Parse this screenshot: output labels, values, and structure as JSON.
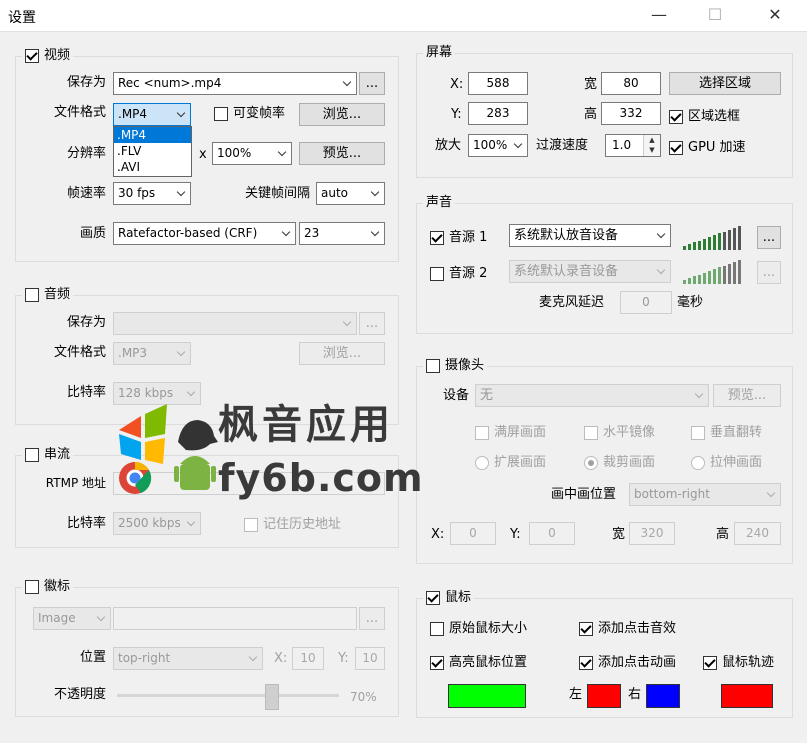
{
  "window": {
    "title": "设置",
    "minimize": "—",
    "maximize": "☐",
    "close": "✕"
  },
  "video": {
    "title": "视频",
    "save_label": "保存为",
    "save_value": "Rec <num>.mp4",
    "more": "...",
    "format_label": "文件格式",
    "format_value": ".MP4",
    "format_options": [
      ".MP4",
      ".FLV",
      ".AVI"
    ],
    "vfr_label": "可变帧率",
    "browse": "浏览...",
    "res_label": "分辨率",
    "res_x": "x",
    "scale_value": "100%",
    "preview": "预览...",
    "fps_label": "帧速率",
    "fps_value": "30 fps",
    "keyframe_label": "关键帧间隔",
    "keyframe_value": "auto",
    "quality_label": "画质",
    "quality_mode": "Ratefactor-based (CRF)",
    "quality_value": "23"
  },
  "audio": {
    "title": "音频",
    "save_label": "保存为",
    "more": "...",
    "format_label": "文件格式",
    "format_value": ".MP3",
    "browse": "浏览...",
    "bitrate_label": "比特率",
    "bitrate_value": "128 kbps"
  },
  "stream": {
    "title": "串流",
    "rtmp_label": "RTMP 地址",
    "bitrate_label": "比特率",
    "bitrate_value": "2500 kbps",
    "remember_label": "记住历史地址"
  },
  "watermark": {
    "title": "徽标",
    "type_value": "Image",
    "more": "...",
    "pos_label": "位置",
    "pos_value": "top-right",
    "x_label": "X:",
    "x_value": "10",
    "y_label": "Y:",
    "y_value": "10",
    "opacity_label": "不透明度",
    "opacity_value": "70%",
    "opacity_level": 0.7
  },
  "screen": {
    "title": "屏幕",
    "x_label": "X:",
    "x_value": "588",
    "y_label": "Y:",
    "y_value": "283",
    "w_label": "宽",
    "w_value": "80",
    "h_label": "高",
    "h_value": "332",
    "select_region": "选择区域",
    "region_frame": "区域选框",
    "zoom_label": "放大",
    "zoom_value": "100%",
    "transition_label": "过渡速度",
    "transition_value": "1.0",
    "gpu_label": "GPU 加速"
  },
  "sound": {
    "title": "声音",
    "src1_label": "音源 1",
    "src1_value": "系统默认放音设备",
    "src2_label": "音源 2",
    "src2_value": "系统默认录音设备",
    "more": "...",
    "mic_delay_label": "麦克风延迟",
    "mic_delay_value": "0",
    "mic_delay_unit": "毫秒"
  },
  "camera": {
    "title": "摄像头",
    "device_label": "设备",
    "device_value": "无",
    "preview": "预览...",
    "fullscreen": "满屏画面",
    "mirror": "水平镜像",
    "flip": "垂直翻转",
    "expand": "扩展画面",
    "crop": "裁剪画面",
    "stretch": "拉伸画面",
    "pip_label": "画中画位置",
    "pip_value": "bottom-right",
    "x_label": "X:",
    "x_value": "0",
    "y_label": "Y:",
    "y_value": "0",
    "w_label": "宽",
    "w_value": "320",
    "h_label": "高",
    "h_value": "240"
  },
  "mouse": {
    "title": "鼠标",
    "original_size": "原始鼠标大小",
    "click_sound": "添加点击音效",
    "highlight": "高亮鼠标位置",
    "click_anim": "添加点击动画",
    "trail": "鼠标轨迹",
    "left_label": "左",
    "right_label": "右",
    "colors": {
      "highlight": "#00ff00",
      "left": "#ff0000",
      "right": "#0000ff",
      "trail": "#ff0000"
    }
  },
  "watermark_overlay": {
    "title": "枫音应用",
    "site": "fy6b.com"
  }
}
